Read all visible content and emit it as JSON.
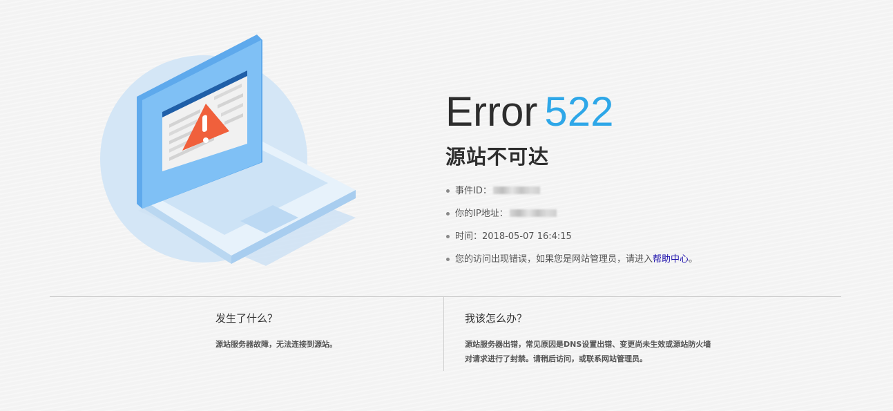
{
  "error": {
    "word": "Error",
    "code": "522",
    "subtitle": "源站不可达"
  },
  "info": {
    "event_id_label": "事件ID：",
    "ip_label": "你的IP地址：",
    "time_label": "时间：",
    "time_value": "2018-05-07 16:4:15",
    "message_prefix": "您的访问出现错误，如果您是网站管理员，请进入",
    "help_link": "帮助中心",
    "message_suffix": "。"
  },
  "left_panel": {
    "heading": "发生了什么？",
    "text": "源站服务器故障，无法连接到源站。"
  },
  "right_panel": {
    "heading": "我该怎么办？",
    "text_line1": "源站服务器出错，常见原因是DNS设置出错、变更尚未生效或源站防火墙",
    "text_line2": "对请求进行了封禁。请稍后访问，或联系网站管理员。"
  },
  "colors": {
    "accent": "#2ea7e8",
    "link": "#1a0dab",
    "warning": "#f0603c"
  },
  "icons": {
    "illustration": "laptop-warning-icon"
  }
}
